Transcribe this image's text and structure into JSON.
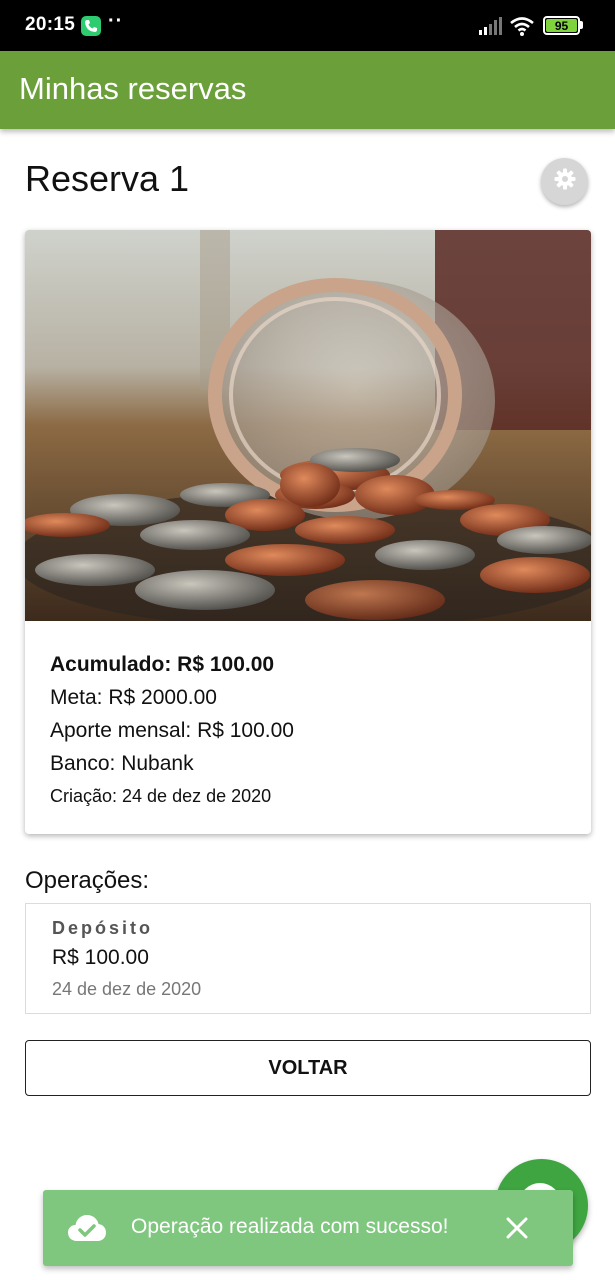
{
  "status_bar": {
    "time": "20:15",
    "dots": "··",
    "battery_level": "95"
  },
  "app_bar": {
    "title": "Minhas reservas"
  },
  "reservation": {
    "title": "Reserva 1",
    "image_description": "coins-spilling-from-jar",
    "accumulated": "Acumulado: R$ 100.00",
    "goal": "Meta: R$ 2000.00",
    "monthly_contribution": "Aporte mensal: R$ 100.00",
    "bank": "Banco: Nubank",
    "created": "Criação: 24 de dez de 2020"
  },
  "operations": {
    "title": "Operações:",
    "items": [
      {
        "type": "Depósito",
        "value": "R$ 100.00",
        "date": "24 de dez de 2020"
      }
    ]
  },
  "back_button": {
    "label": "VOLTAR"
  },
  "snackbar": {
    "message": "Operação realizada com sucesso!",
    "icon": "cloud-check-icon"
  },
  "colors": {
    "app_bar": "#6a9f3a",
    "fab": "#3ea540",
    "snackbar": "#7fc77e"
  }
}
